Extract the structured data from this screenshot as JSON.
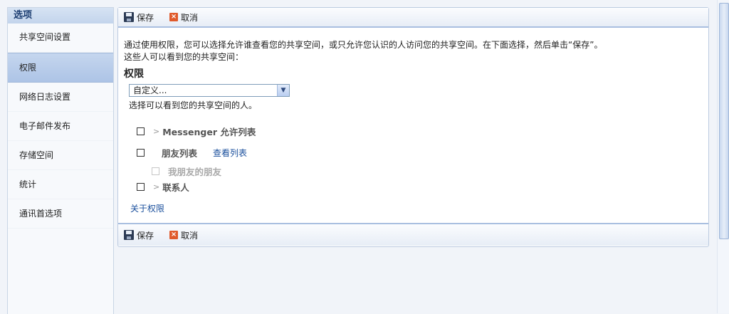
{
  "sidebar": {
    "title": "选项",
    "items": [
      {
        "label": "共享空间设置"
      },
      {
        "label": "权限"
      },
      {
        "label": "网络日志设置"
      },
      {
        "label": "电子邮件发布"
      },
      {
        "label": "存储空间"
      },
      {
        "label": "统计"
      },
      {
        "label": "通讯首选项"
      }
    ]
  },
  "toolbar": {
    "save_label": "保存",
    "cancel_label": "取消"
  },
  "main": {
    "description_line1": "通过使用权限，您可以选择允许谁查看您的共享空间，或只允许您认识的人访问您的共享空间。在下面选择，然后单击“保存”。",
    "description_line2": "这些人可以看到您的共享空间：",
    "section_title": "权限",
    "select_value": "自定义...",
    "select_hint": "选择可以看到您的共享空间的人。",
    "options": {
      "messenger": "Messenger 允许列表",
      "friends": "朋友列表",
      "view_list": "查看列表",
      "friends_of_friends": "我朋友的朋友",
      "contacts": "联系人"
    },
    "about_link": "关于权限"
  }
}
